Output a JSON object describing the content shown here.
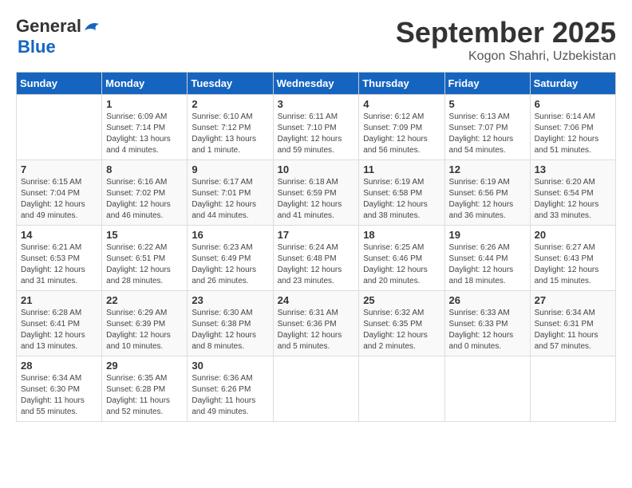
{
  "header": {
    "logo_line1": "General",
    "logo_line2": "Blue",
    "month_title": "September 2025",
    "location": "Kogon Shahri, Uzbekistan"
  },
  "days_of_week": [
    "Sunday",
    "Monday",
    "Tuesday",
    "Wednesday",
    "Thursday",
    "Friday",
    "Saturday"
  ],
  "weeks": [
    [
      {
        "day": "",
        "sunrise": "",
        "sunset": "",
        "daylight": ""
      },
      {
        "day": "1",
        "sunrise": "Sunrise: 6:09 AM",
        "sunset": "Sunset: 7:14 PM",
        "daylight": "Daylight: 13 hours and 4 minutes."
      },
      {
        "day": "2",
        "sunrise": "Sunrise: 6:10 AM",
        "sunset": "Sunset: 7:12 PM",
        "daylight": "Daylight: 13 hours and 1 minute."
      },
      {
        "day": "3",
        "sunrise": "Sunrise: 6:11 AM",
        "sunset": "Sunset: 7:10 PM",
        "daylight": "Daylight: 12 hours and 59 minutes."
      },
      {
        "day": "4",
        "sunrise": "Sunrise: 6:12 AM",
        "sunset": "Sunset: 7:09 PM",
        "daylight": "Daylight: 12 hours and 56 minutes."
      },
      {
        "day": "5",
        "sunrise": "Sunrise: 6:13 AM",
        "sunset": "Sunset: 7:07 PM",
        "daylight": "Daylight: 12 hours and 54 minutes."
      },
      {
        "day": "6",
        "sunrise": "Sunrise: 6:14 AM",
        "sunset": "Sunset: 7:06 PM",
        "daylight": "Daylight: 12 hours and 51 minutes."
      }
    ],
    [
      {
        "day": "7",
        "sunrise": "Sunrise: 6:15 AM",
        "sunset": "Sunset: 7:04 PM",
        "daylight": "Daylight: 12 hours and 49 minutes."
      },
      {
        "day": "8",
        "sunrise": "Sunrise: 6:16 AM",
        "sunset": "Sunset: 7:02 PM",
        "daylight": "Daylight: 12 hours and 46 minutes."
      },
      {
        "day": "9",
        "sunrise": "Sunrise: 6:17 AM",
        "sunset": "Sunset: 7:01 PM",
        "daylight": "Daylight: 12 hours and 44 minutes."
      },
      {
        "day": "10",
        "sunrise": "Sunrise: 6:18 AM",
        "sunset": "Sunset: 6:59 PM",
        "daylight": "Daylight: 12 hours and 41 minutes."
      },
      {
        "day": "11",
        "sunrise": "Sunrise: 6:19 AM",
        "sunset": "Sunset: 6:58 PM",
        "daylight": "Daylight: 12 hours and 38 minutes."
      },
      {
        "day": "12",
        "sunrise": "Sunrise: 6:19 AM",
        "sunset": "Sunset: 6:56 PM",
        "daylight": "Daylight: 12 hours and 36 minutes."
      },
      {
        "day": "13",
        "sunrise": "Sunrise: 6:20 AM",
        "sunset": "Sunset: 6:54 PM",
        "daylight": "Daylight: 12 hours and 33 minutes."
      }
    ],
    [
      {
        "day": "14",
        "sunrise": "Sunrise: 6:21 AM",
        "sunset": "Sunset: 6:53 PM",
        "daylight": "Daylight: 12 hours and 31 minutes."
      },
      {
        "day": "15",
        "sunrise": "Sunrise: 6:22 AM",
        "sunset": "Sunset: 6:51 PM",
        "daylight": "Daylight: 12 hours and 28 minutes."
      },
      {
        "day": "16",
        "sunrise": "Sunrise: 6:23 AM",
        "sunset": "Sunset: 6:49 PM",
        "daylight": "Daylight: 12 hours and 26 minutes."
      },
      {
        "day": "17",
        "sunrise": "Sunrise: 6:24 AM",
        "sunset": "Sunset: 6:48 PM",
        "daylight": "Daylight: 12 hours and 23 minutes."
      },
      {
        "day": "18",
        "sunrise": "Sunrise: 6:25 AM",
        "sunset": "Sunset: 6:46 PM",
        "daylight": "Daylight: 12 hours and 20 minutes."
      },
      {
        "day": "19",
        "sunrise": "Sunrise: 6:26 AM",
        "sunset": "Sunset: 6:44 PM",
        "daylight": "Daylight: 12 hours and 18 minutes."
      },
      {
        "day": "20",
        "sunrise": "Sunrise: 6:27 AM",
        "sunset": "Sunset: 6:43 PM",
        "daylight": "Daylight: 12 hours and 15 minutes."
      }
    ],
    [
      {
        "day": "21",
        "sunrise": "Sunrise: 6:28 AM",
        "sunset": "Sunset: 6:41 PM",
        "daylight": "Daylight: 12 hours and 13 minutes."
      },
      {
        "day": "22",
        "sunrise": "Sunrise: 6:29 AM",
        "sunset": "Sunset: 6:39 PM",
        "daylight": "Daylight: 12 hours and 10 minutes."
      },
      {
        "day": "23",
        "sunrise": "Sunrise: 6:30 AM",
        "sunset": "Sunset: 6:38 PM",
        "daylight": "Daylight: 12 hours and 8 minutes."
      },
      {
        "day": "24",
        "sunrise": "Sunrise: 6:31 AM",
        "sunset": "Sunset: 6:36 PM",
        "daylight": "Daylight: 12 hours and 5 minutes."
      },
      {
        "day": "25",
        "sunrise": "Sunrise: 6:32 AM",
        "sunset": "Sunset: 6:35 PM",
        "daylight": "Daylight: 12 hours and 2 minutes."
      },
      {
        "day": "26",
        "sunrise": "Sunrise: 6:33 AM",
        "sunset": "Sunset: 6:33 PM",
        "daylight": "Daylight: 12 hours and 0 minutes."
      },
      {
        "day": "27",
        "sunrise": "Sunrise: 6:34 AM",
        "sunset": "Sunset: 6:31 PM",
        "daylight": "Daylight: 11 hours and 57 minutes."
      }
    ],
    [
      {
        "day": "28",
        "sunrise": "Sunrise: 6:34 AM",
        "sunset": "Sunset: 6:30 PM",
        "daylight": "Daylight: 11 hours and 55 minutes."
      },
      {
        "day": "29",
        "sunrise": "Sunrise: 6:35 AM",
        "sunset": "Sunset: 6:28 PM",
        "daylight": "Daylight: 11 hours and 52 minutes."
      },
      {
        "day": "30",
        "sunrise": "Sunrise: 6:36 AM",
        "sunset": "Sunset: 6:26 PM",
        "daylight": "Daylight: 11 hours and 49 minutes."
      },
      {
        "day": "",
        "sunrise": "",
        "sunset": "",
        "daylight": ""
      },
      {
        "day": "",
        "sunrise": "",
        "sunset": "",
        "daylight": ""
      },
      {
        "day": "",
        "sunrise": "",
        "sunset": "",
        "daylight": ""
      },
      {
        "day": "",
        "sunrise": "",
        "sunset": "",
        "daylight": ""
      }
    ]
  ]
}
